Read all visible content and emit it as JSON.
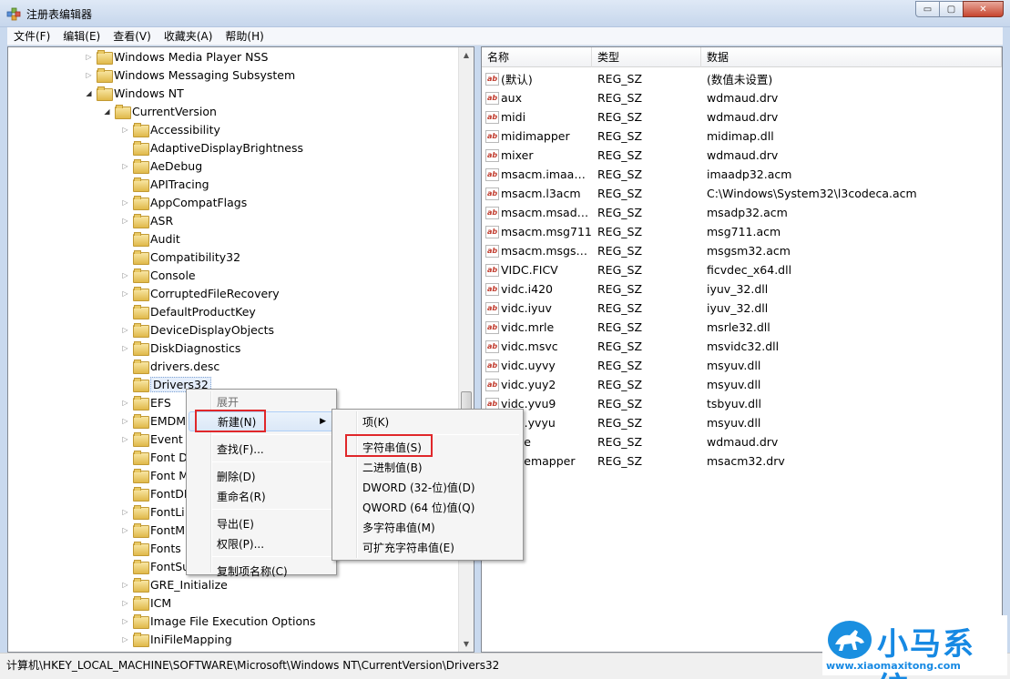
{
  "window": {
    "title": "注册表编辑器",
    "min_glyph": "▭",
    "max_glyph": "▢",
    "close_glyph": "✕"
  },
  "menu": [
    "文件(F)",
    "编辑(E)",
    "查看(V)",
    "收藏夹(A)",
    "帮助(H)"
  ],
  "tree": [
    {
      "label": "Windows Media Player NSS",
      "indent": 1,
      "state": "collapsed"
    },
    {
      "label": "Windows Messaging Subsystem",
      "indent": 1,
      "state": "collapsed"
    },
    {
      "label": "Windows NT",
      "indent": 1,
      "state": "expanded"
    },
    {
      "label": "CurrentVersion",
      "indent": 2,
      "state": "expanded"
    },
    {
      "label": "Accessibility",
      "indent": 3,
      "state": "collapsed"
    },
    {
      "label": "AdaptiveDisplayBrightness",
      "indent": 3,
      "state": "none"
    },
    {
      "label": "AeDebug",
      "indent": 3,
      "state": "collapsed"
    },
    {
      "label": "APITracing",
      "indent": 3,
      "state": "none"
    },
    {
      "label": "AppCompatFlags",
      "indent": 3,
      "state": "collapsed"
    },
    {
      "label": "ASR",
      "indent": 3,
      "state": "collapsed"
    },
    {
      "label": "Audit",
      "indent": 3,
      "state": "none"
    },
    {
      "label": "Compatibility32",
      "indent": 3,
      "state": "none"
    },
    {
      "label": "Console",
      "indent": 3,
      "state": "collapsed"
    },
    {
      "label": "CorruptedFileRecovery",
      "indent": 3,
      "state": "collapsed"
    },
    {
      "label": "DefaultProductKey",
      "indent": 3,
      "state": "none"
    },
    {
      "label": "DeviceDisplayObjects",
      "indent": 3,
      "state": "collapsed"
    },
    {
      "label": "DiskDiagnostics",
      "indent": 3,
      "state": "collapsed"
    },
    {
      "label": "drivers.desc",
      "indent": 3,
      "state": "none"
    },
    {
      "label": "Drivers32",
      "indent": 3,
      "state": "none",
      "selected": true
    },
    {
      "label": "EFS",
      "indent": 3,
      "state": "collapsed"
    },
    {
      "label": "EMDM",
      "indent": 3,
      "state": "collapsed"
    },
    {
      "label": "Event ",
      "indent": 3,
      "state": "collapsed"
    },
    {
      "label": "Font D",
      "indent": 3,
      "state": "none"
    },
    {
      "label": "Font M",
      "indent": 3,
      "state": "none"
    },
    {
      "label": "FontDI",
      "indent": 3,
      "state": "none"
    },
    {
      "label": "FontLi",
      "indent": 3,
      "state": "collapsed"
    },
    {
      "label": "FontM",
      "indent": 3,
      "state": "collapsed"
    },
    {
      "label": "Fonts",
      "indent": 3,
      "state": "none"
    },
    {
      "label": "FontSu",
      "indent": 3,
      "state": "none"
    },
    {
      "label": "GRE_Initialize",
      "indent": 3,
      "state": "collapsed"
    },
    {
      "label": "ICM",
      "indent": 3,
      "state": "collapsed"
    },
    {
      "label": "Image File Execution Options",
      "indent": 3,
      "state": "collapsed"
    },
    {
      "label": "IniFileMapping",
      "indent": 3,
      "state": "collapsed"
    }
  ],
  "list": {
    "columns": [
      "名称",
      "类型",
      "数据"
    ],
    "rows": [
      {
        "name": "(默认)",
        "type": "REG_SZ",
        "data": "(数值未设置)"
      },
      {
        "name": "aux",
        "type": "REG_SZ",
        "data": "wdmaud.drv"
      },
      {
        "name": "midi",
        "type": "REG_SZ",
        "data": "wdmaud.drv"
      },
      {
        "name": "midimapper",
        "type": "REG_SZ",
        "data": "midimap.dll"
      },
      {
        "name": "mixer",
        "type": "REG_SZ",
        "data": "wdmaud.drv"
      },
      {
        "name": "msacm.imaad...",
        "type": "REG_SZ",
        "data": "imaadp32.acm"
      },
      {
        "name": "msacm.l3acm",
        "type": "REG_SZ",
        "data": "C:\\Windows\\System32\\l3codeca.acm"
      },
      {
        "name": "msacm.msadp...",
        "type": "REG_SZ",
        "data": "msadp32.acm"
      },
      {
        "name": "msacm.msg711",
        "type": "REG_SZ",
        "data": "msg711.acm"
      },
      {
        "name": "msacm.msgsm...",
        "type": "REG_SZ",
        "data": "msgsm32.acm"
      },
      {
        "name": "VIDC.FICV",
        "type": "REG_SZ",
        "data": "ficvdec_x64.dll"
      },
      {
        "name": "vidc.i420",
        "type": "REG_SZ",
        "data": "iyuv_32.dll"
      },
      {
        "name": "vidc.iyuv",
        "type": "REG_SZ",
        "data": "iyuv_32.dll"
      },
      {
        "name": "vidc.mrle",
        "type": "REG_SZ",
        "data": "msrle32.dll"
      },
      {
        "name": "vidc.msvc",
        "type": "REG_SZ",
        "data": "msvidc32.dll"
      },
      {
        "name": "vidc.uyvy",
        "type": "REG_SZ",
        "data": "msyuv.dll"
      },
      {
        "name": "vidc.yuy2",
        "type": "REG_SZ",
        "data": "msyuv.dll"
      },
      {
        "name": "vidc.yvu9",
        "type": "REG_SZ",
        "data": "tsbyuv.dll"
      },
      {
        "name": "vidc.yvyu",
        "type": "REG_SZ",
        "data": "msyuv.dll"
      },
      {
        "name": "wave",
        "type": "REG_SZ",
        "data": "wdmaud.drv"
      },
      {
        "name": "wavemapper",
        "type": "REG_SZ",
        "data": "msacm32.drv"
      }
    ]
  },
  "context_menu": {
    "items": [
      {
        "label": "展开",
        "disabled": true
      },
      {
        "label": "新建(N)",
        "submenu": true,
        "hot": true
      },
      {
        "label": "查找(F)...",
        "sep_before": true
      },
      {
        "label": "删除(D)",
        "sep_before": true
      },
      {
        "label": "重命名(R)"
      },
      {
        "label": "导出(E)",
        "sep_before": true
      },
      {
        "label": "权限(P)..."
      },
      {
        "label": "复制项名称(C)",
        "sep_before": true
      }
    ]
  },
  "submenu": {
    "items": [
      {
        "label": "项(K)"
      },
      {
        "label": "字符串值(S)",
        "sep_before": true,
        "highlighted": true
      },
      {
        "label": "二进制值(B)"
      },
      {
        "label": "DWORD (32-位)值(D)"
      },
      {
        "label": "QWORD (64 位)值(Q)"
      },
      {
        "label": "多字符串值(M)"
      },
      {
        "label": "可扩充字符串值(E)"
      }
    ]
  },
  "status": "计算机\\HKEY_LOCAL_MACHINE\\SOFTWARE\\Microsoft\\Windows NT\\CurrentVersion\\Drivers32",
  "watermark": {
    "title": "小马系统",
    "url": "www.xiaomaxitong.com"
  },
  "colors": {
    "highlight_box": "#e0272a",
    "watermark_blue": "#1689e3"
  }
}
